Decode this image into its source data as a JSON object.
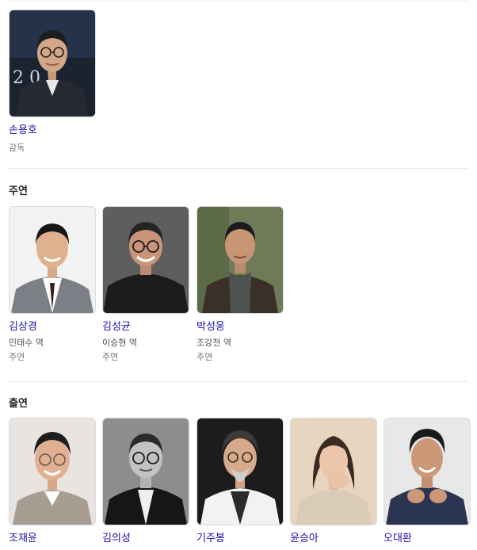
{
  "director": {
    "name": "손용호",
    "kind": "감독",
    "backdrop_text": "2 0 5 ."
  },
  "sections": [
    {
      "title": "주연"
    },
    {
      "title": "출연"
    }
  ],
  "leads": [
    {
      "name": "김상경",
      "role": "민태수 역",
      "kind": "주연"
    },
    {
      "name": "김성균",
      "role": "이승현 역",
      "kind": "주연"
    },
    {
      "name": "박성웅",
      "role": "조강천 역",
      "kind": "주연"
    }
  ],
  "cast": [
    {
      "name": "조재윤"
    },
    {
      "name": "김의성"
    },
    {
      "name": "기주봉"
    },
    {
      "name": "윤승아"
    },
    {
      "name": "오대환"
    }
  ],
  "colors": {
    "link": "#1a0dab",
    "divider": "#ebebeb",
    "muted": "#70757a"
  }
}
